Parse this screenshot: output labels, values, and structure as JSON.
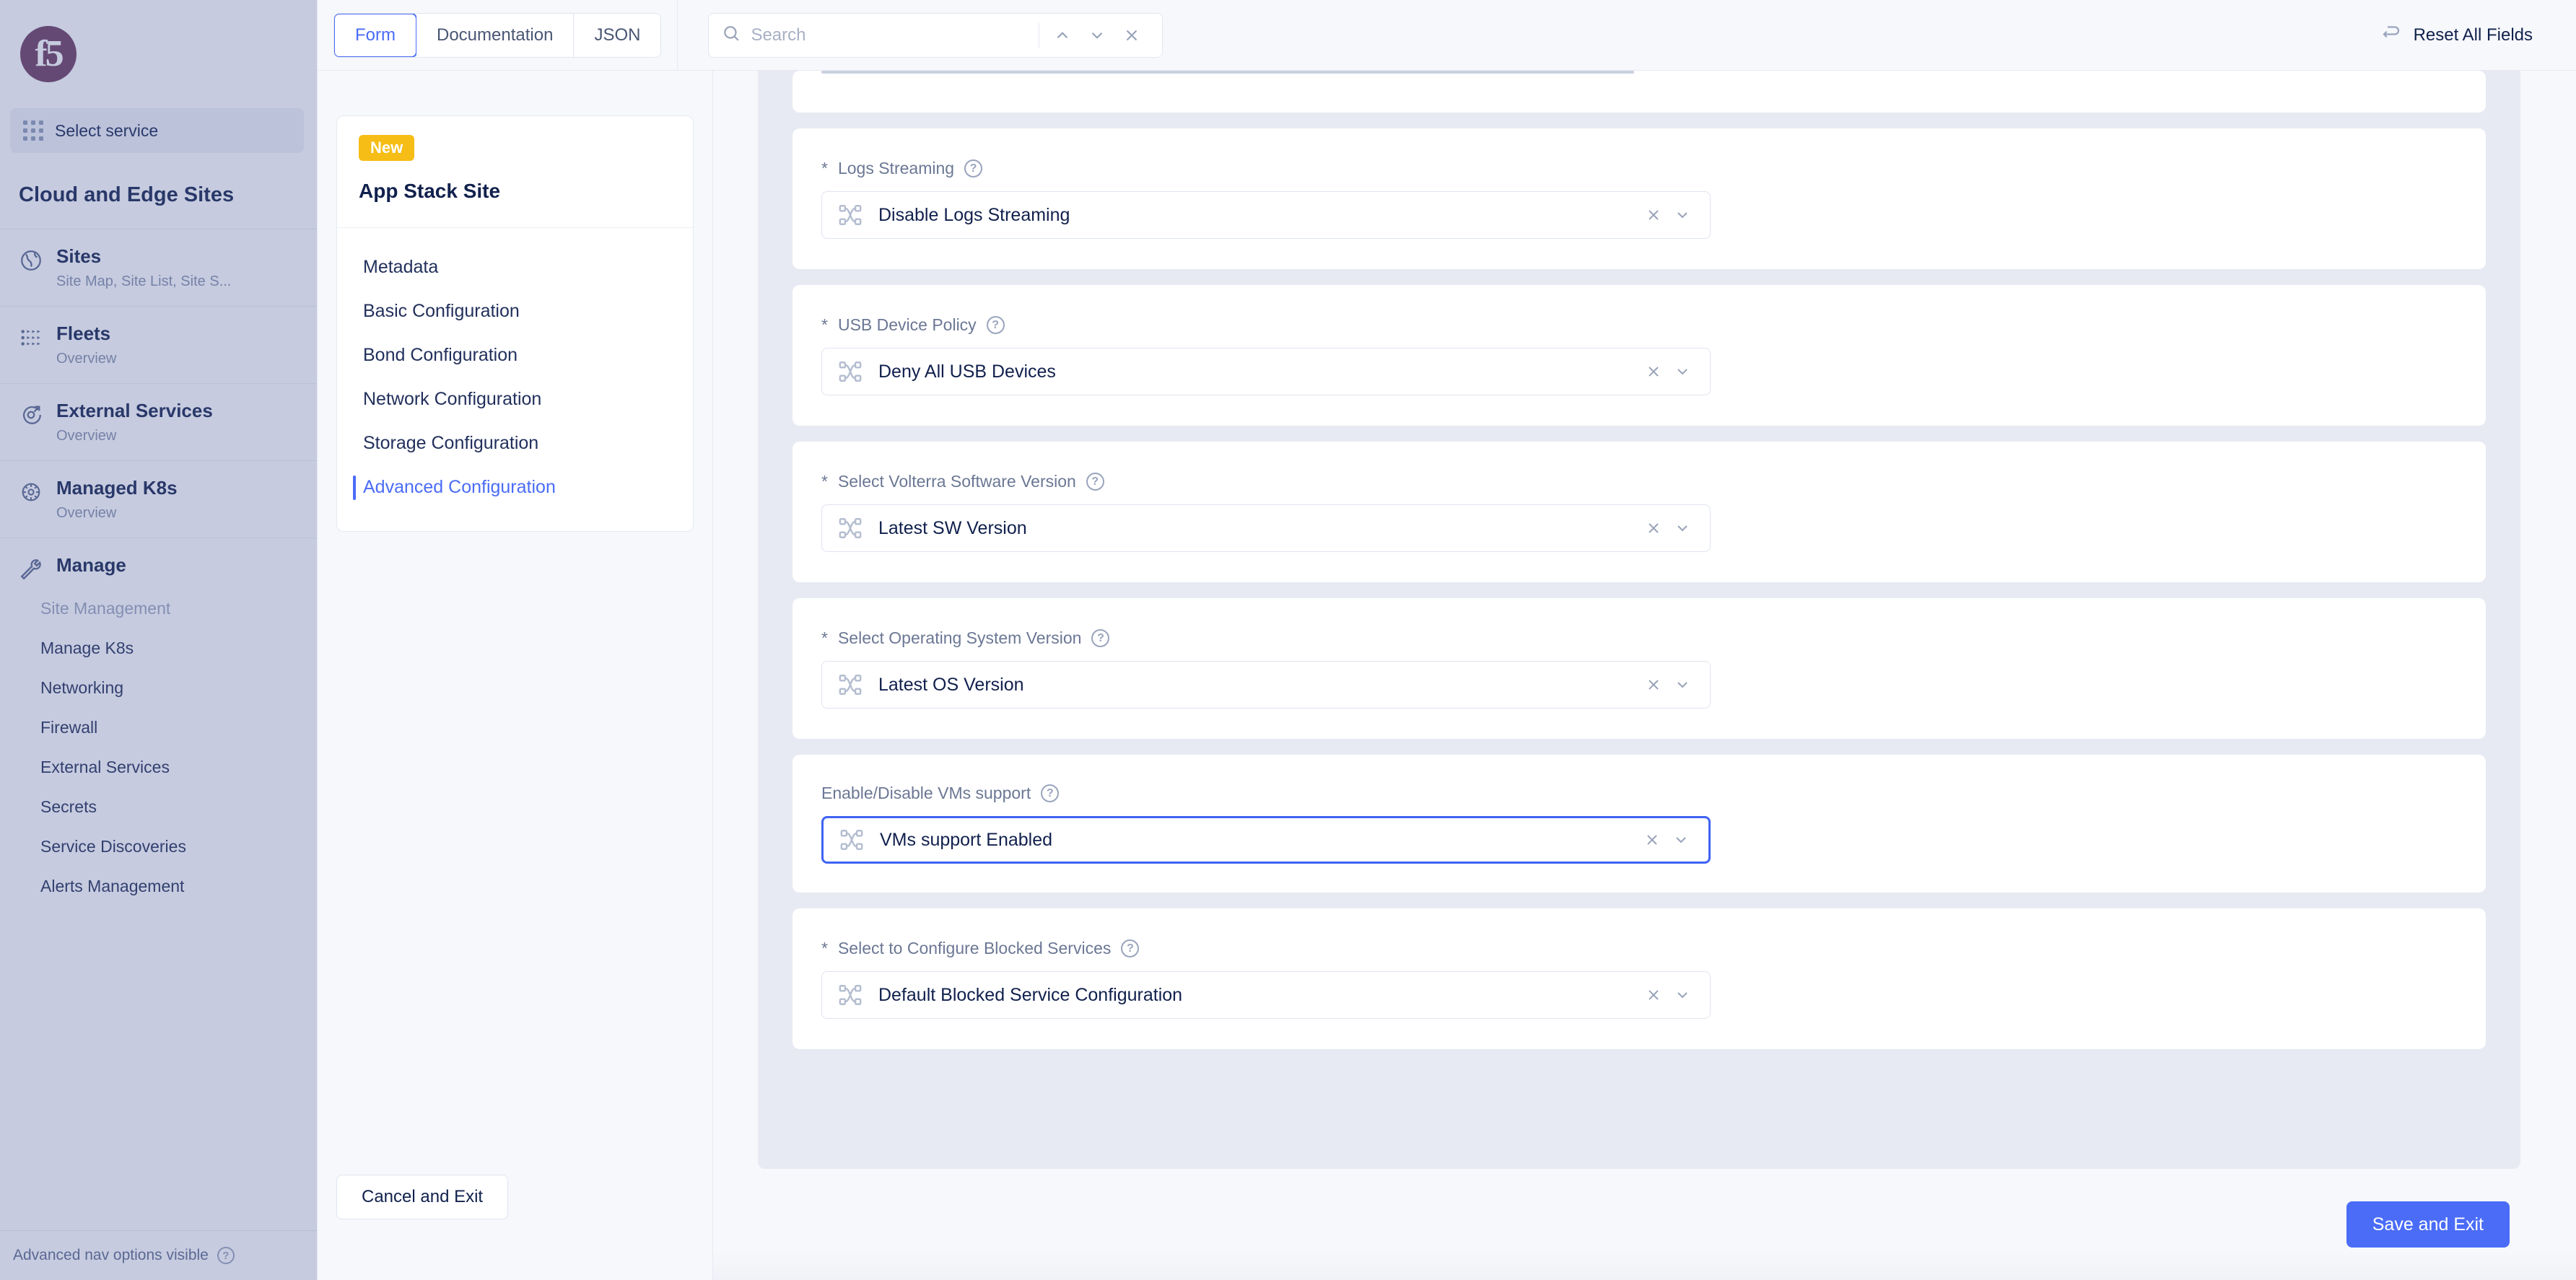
{
  "left_nav": {
    "logo_text": "f5",
    "service_selector": {
      "label": "Select service",
      "icon": "grid-apps-icon"
    },
    "section_title": "Cloud and Edge Sites",
    "items": [
      {
        "label": "Sites",
        "sub": "Site Map, Site List, Site S...",
        "icon": "globe-icon"
      },
      {
        "label": "Fleets",
        "sub": "Overview",
        "icon": "fleets-icon"
      },
      {
        "label": "External Services",
        "sub": "Overview",
        "icon": "external-services-icon"
      },
      {
        "label": "Managed K8s",
        "sub": "Overview",
        "icon": "kubernetes-icon"
      },
      {
        "label": "Manage",
        "sub": "",
        "icon": "wrench-icon"
      }
    ],
    "manage_sub_items": [
      {
        "label": "Site Management",
        "muted": true
      },
      {
        "label": "Manage K8s",
        "muted": false
      },
      {
        "label": "Networking",
        "muted": false
      },
      {
        "label": "Firewall",
        "muted": false
      },
      {
        "label": "External Services",
        "muted": false
      },
      {
        "label": "Secrets",
        "muted": false
      },
      {
        "label": "Service Discoveries",
        "muted": false
      },
      {
        "label": "Alerts Management",
        "muted": false
      }
    ],
    "footer": {
      "label": "Advanced nav options visible",
      "icon": "help-circle-icon"
    }
  },
  "topbar": {
    "tabs": [
      {
        "label": "Form",
        "active": true
      },
      {
        "label": "Documentation",
        "active": false
      },
      {
        "label": "JSON",
        "active": false
      }
    ],
    "search": {
      "placeholder": "Search",
      "value": ""
    },
    "search_prev_icon": "chevron-up-icon",
    "search_next_icon": "chevron-down-icon",
    "search_close_icon": "close-icon",
    "reset_label": "Reset All Fields",
    "reset_icon": "undo-arrow-icon"
  },
  "form_nav": {
    "badge": "New",
    "title": "App Stack Site",
    "sections": [
      {
        "label": "Metadata",
        "active": false
      },
      {
        "label": "Basic Configuration",
        "active": false
      },
      {
        "label": "Bond Configuration",
        "active": false
      },
      {
        "label": "Network Configuration",
        "active": false
      },
      {
        "label": "Storage Configuration",
        "active": false
      },
      {
        "label": "Advanced Configuration",
        "active": true
      }
    ],
    "cancel_label": "Cancel and Exit"
  },
  "fields": [
    {
      "label": "Logs Streaming",
      "required": true,
      "value": "Disable Logs Streaming",
      "focused": false,
      "leading_icon": "shuffle-nodes-icon",
      "clear_icon": "close-icon",
      "chevron_icon": "chevron-down-icon",
      "hint_icon": "help-circle-icon"
    },
    {
      "label": "USB Device Policy",
      "required": true,
      "value": "Deny All USB Devices",
      "focused": false,
      "leading_icon": "shuffle-nodes-icon",
      "clear_icon": "close-icon",
      "chevron_icon": "chevron-down-icon",
      "hint_icon": "help-circle-icon"
    },
    {
      "label": "Select Volterra Software Version",
      "required": true,
      "value": "Latest SW Version",
      "focused": false,
      "leading_icon": "shuffle-nodes-icon",
      "clear_icon": "close-icon",
      "chevron_icon": "chevron-down-icon",
      "hint_icon": "help-circle-icon"
    },
    {
      "label": "Select Operating System Version",
      "required": true,
      "value": "Latest OS Version",
      "focused": false,
      "leading_icon": "shuffle-nodes-icon",
      "clear_icon": "close-icon",
      "chevron_icon": "chevron-down-icon",
      "hint_icon": "help-circle-icon"
    },
    {
      "label": "Enable/Disable VMs support",
      "required": false,
      "value": "VMs support Enabled",
      "focused": true,
      "leading_icon": "shuffle-nodes-icon",
      "clear_icon": "close-icon",
      "chevron_icon": "chevron-down-icon",
      "hint_icon": "help-circle-icon"
    },
    {
      "label": "Select to Configure Blocked Services",
      "required": true,
      "value": "Default Blocked Service Configuration",
      "focused": false,
      "leading_icon": "shuffle-nodes-icon",
      "clear_icon": "close-icon",
      "chevron_icon": "chevron-down-icon",
      "hint_icon": "help-circle-icon"
    }
  ],
  "footer": {
    "save_label": "Save and Exit"
  },
  "colors": {
    "accent": "#4a6cf7",
    "badge_new": "#f6bd16",
    "text_dark": "#11214d",
    "label_muted": "#6b7794",
    "f5_brand": "#6d3a5e",
    "focus_border": "#3f63f3"
  }
}
